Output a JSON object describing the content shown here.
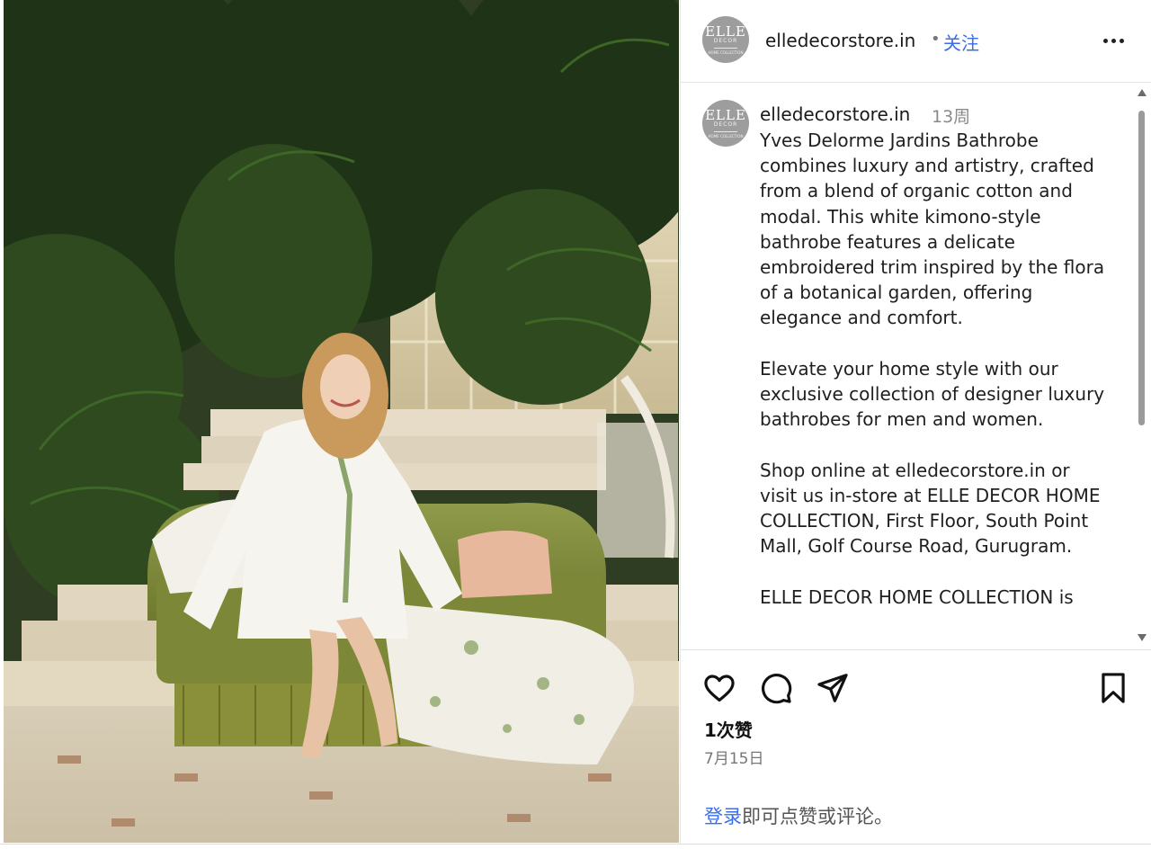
{
  "account": {
    "username": "elledecorstore.in",
    "avatar_logo": "ELLE",
    "avatar_sub": "DECOR",
    "avatar_tiny": "HOME COLLECTION",
    "separator": "•",
    "follow_label": "关注",
    "more_icon": "more-horizontal-icon"
  },
  "caption": {
    "username": "elledecorstore.in",
    "time_ago": "13周",
    "paragraphs": [
      "Yves Delorme Jardins Bathrobe combines luxury and artistry, crafted from a blend of organic cotton and modal. This white kimono-style bathrobe features a delicate embroidered trim inspired by the flora of a botanical garden, offering elegance and comfort.",
      "Elevate your home style with our exclusive collection of designer luxury bathrobes for men and women.",
      "Shop online at elledecorstore.in or visit us in-store at ELLE DECOR HOME COLLECTION, First Floor, South Point Mall, Golf Course Road, Gurugram.",
      "ELLE DECOR HOME COLLECTION is"
    ]
  },
  "actions": {
    "like_icon": "heart-icon",
    "comment_icon": "comment-icon",
    "share_icon": "send-icon",
    "save_icon": "bookmark-icon"
  },
  "stats": {
    "likes": "1次赞",
    "date": "7月15日"
  },
  "footer": {
    "login_link": "登录",
    "login_rest": "即可点赞或评论。"
  },
  "colors": {
    "link": "#3a6ee8",
    "avatar_bg": "#9d9d9d",
    "muted": "#8a8a8a"
  }
}
